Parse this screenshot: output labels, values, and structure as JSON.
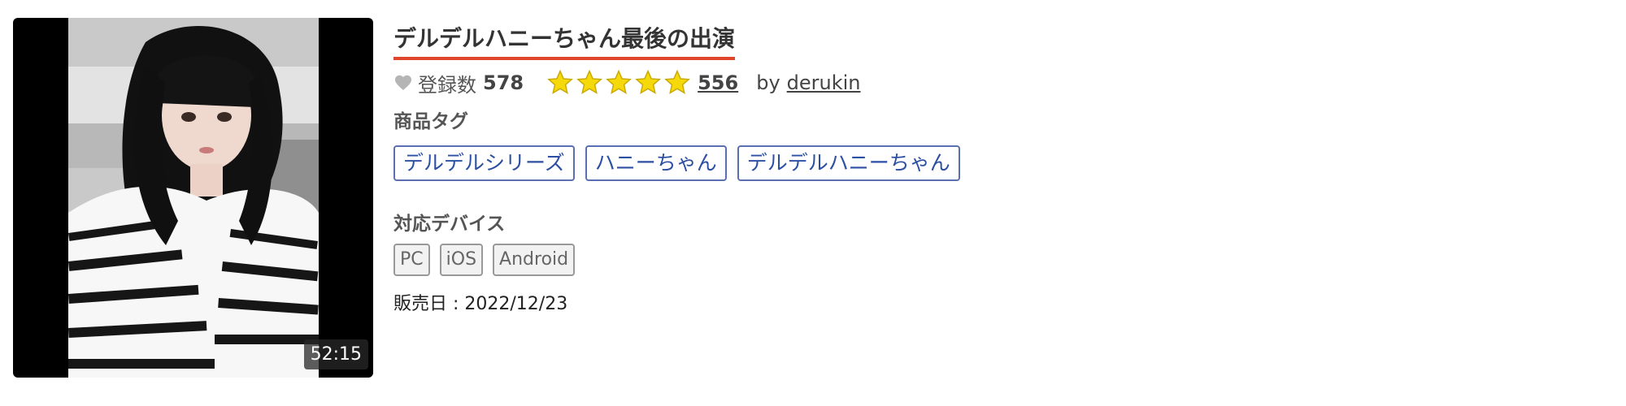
{
  "thumbnail": {
    "duration": "52:15"
  },
  "title": "デルデルハニーちゃん最後の出演",
  "stats": {
    "heart_icon": "heart-icon",
    "registration_label": "登録数",
    "registration_count": "578",
    "rating_stars": 5,
    "star_color": "#f5d90a",
    "review_count": "556",
    "by_label": "by",
    "author": "derukin"
  },
  "tags": {
    "label": "商品タグ",
    "items": [
      "デルデルシリーズ",
      "ハニーちゃん",
      "デルデルハニーちゃん"
    ]
  },
  "devices": {
    "label": "対応デバイス",
    "items": [
      "PC",
      "iOS",
      "Android"
    ]
  },
  "release": {
    "text": "販売日 : 2022/12/23"
  },
  "colors": {
    "title_underline": "#e0452c",
    "tag_border": "#5b6fb3",
    "tag_text": "#2c4fa3"
  }
}
